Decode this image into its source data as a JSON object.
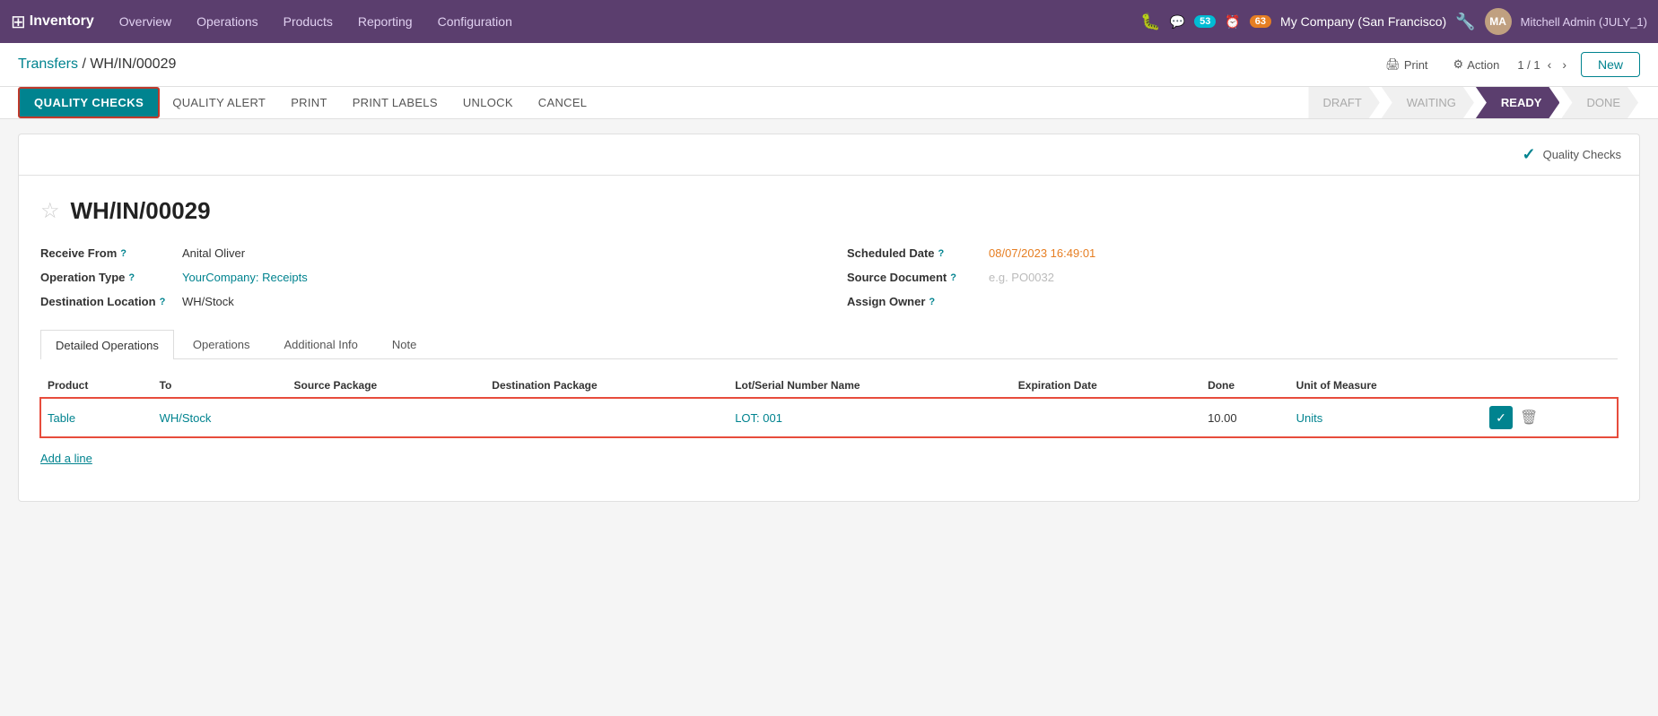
{
  "app": {
    "name": "Inventory",
    "grid_icon": "⊞"
  },
  "topnav": {
    "items": [
      {
        "label": "Overview",
        "id": "overview"
      },
      {
        "label": "Operations",
        "id": "operations"
      },
      {
        "label": "Products",
        "id": "products"
      },
      {
        "label": "Reporting",
        "id": "reporting"
      },
      {
        "label": "Configuration",
        "id": "configuration"
      }
    ],
    "bug_icon": "🐛",
    "chat_count": "53",
    "clock_count": "63",
    "company": "My Company (San Francisco)",
    "settings_icon": "⚙",
    "user": "Mitchell Admin (JULY_1)"
  },
  "header": {
    "breadcrumb_parent": "Transfers",
    "breadcrumb_sep": "/",
    "breadcrumb_current": "WH/IN/00029",
    "print_label": "Print",
    "action_label": "Action",
    "page_position": "1 / 1",
    "new_label": "New"
  },
  "action_bar": {
    "quality_checks": "QUALITY CHECKS",
    "quality_alert": "QUALITY ALERT",
    "print": "PRINT",
    "print_labels": "PRINT LABELS",
    "unlock": "UNLOCK",
    "cancel": "CANCEL"
  },
  "status": {
    "steps": [
      {
        "label": "DRAFT",
        "state": "inactive"
      },
      {
        "label": "WAITING",
        "state": "inactive"
      },
      {
        "label": "READY",
        "state": "active"
      },
      {
        "label": "DONE",
        "state": "inactive"
      }
    ]
  },
  "quality_sidebar": {
    "check_icon": "✓",
    "label": "Quality Checks"
  },
  "record": {
    "id": "WH/IN/00029",
    "star_icon": "☆",
    "fields": {
      "receive_from_label": "Receive From",
      "receive_from_value": "Anital Oliver",
      "operation_type_label": "Operation Type",
      "operation_type_value": "YourCompany: Receipts",
      "destination_location_label": "Destination Location",
      "destination_location_value": "WH/Stock",
      "scheduled_date_label": "Scheduled Date",
      "scheduled_date_value": "08/07/2023 16:49:01",
      "source_document_label": "Source Document",
      "source_document_placeholder": "e.g. PO0032",
      "assign_owner_label": "Assign Owner"
    }
  },
  "tabs": [
    {
      "label": "Detailed Operations",
      "id": "detailed-operations",
      "active": true
    },
    {
      "label": "Operations",
      "id": "operations-tab",
      "active": false
    },
    {
      "label": "Additional Info",
      "id": "additional-info",
      "active": false
    },
    {
      "label": "Note",
      "id": "note",
      "active": false
    }
  ],
  "table": {
    "columns": [
      {
        "label": "Product"
      },
      {
        "label": "To"
      },
      {
        "label": "Source Package"
      },
      {
        "label": "Destination Package"
      },
      {
        "label": "Lot/Serial Number Name"
      },
      {
        "label": "Expiration Date"
      },
      {
        "label": "Done"
      },
      {
        "label": "Unit of Measure"
      }
    ],
    "rows": [
      {
        "product": "Table",
        "to": "WH/Stock",
        "source_package": "",
        "destination_package": "",
        "lot_serial": "LOT: 001",
        "expiration_date": "",
        "done": "10.00",
        "unit_of_measure": "Units"
      }
    ],
    "add_line": "Add a line"
  }
}
